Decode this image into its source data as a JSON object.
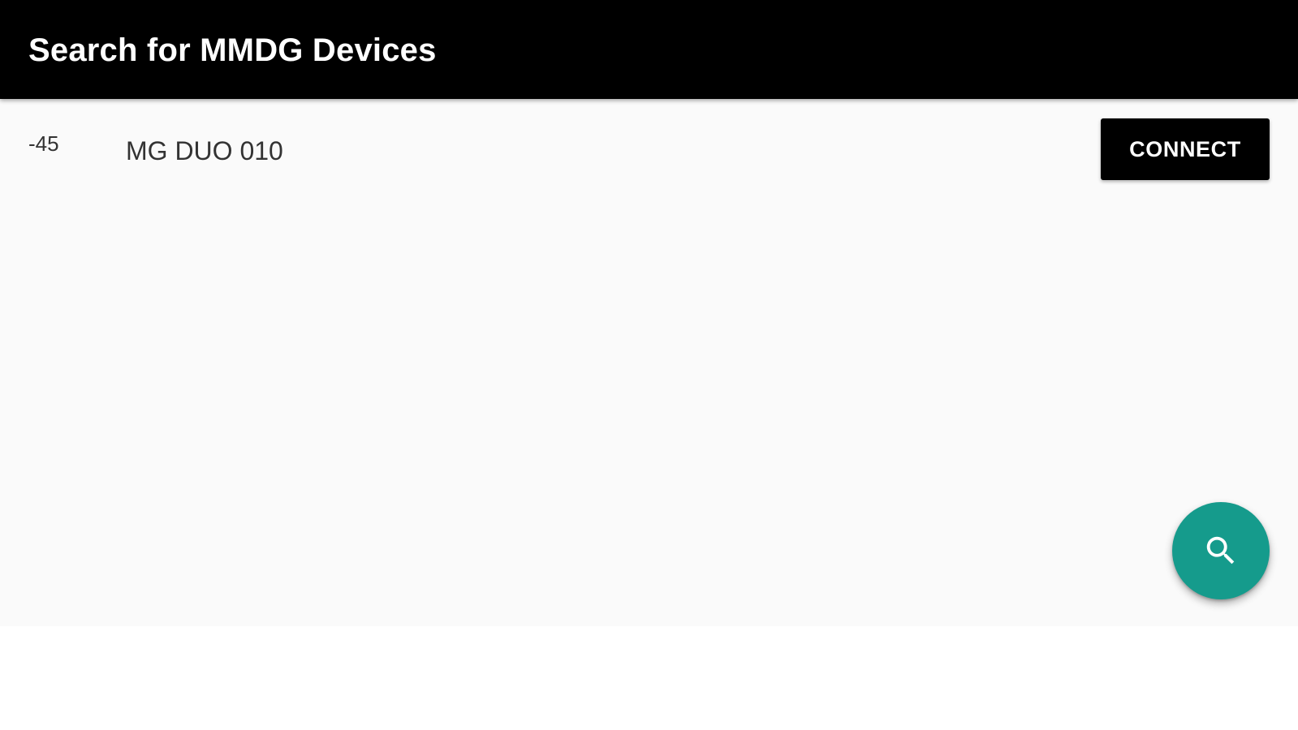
{
  "appbar": {
    "title": "Search for MMDG Devices"
  },
  "devices": [
    {
      "rssi": "-45",
      "name": "MG DUO 010",
      "action_label": "CONNECT"
    }
  ],
  "fab": {
    "icon": "search-icon",
    "color": "#159b8c"
  },
  "colors": {
    "appbar": "#000000",
    "background": "#fafafa",
    "button": "#000000",
    "fab": "#159b8c"
  }
}
